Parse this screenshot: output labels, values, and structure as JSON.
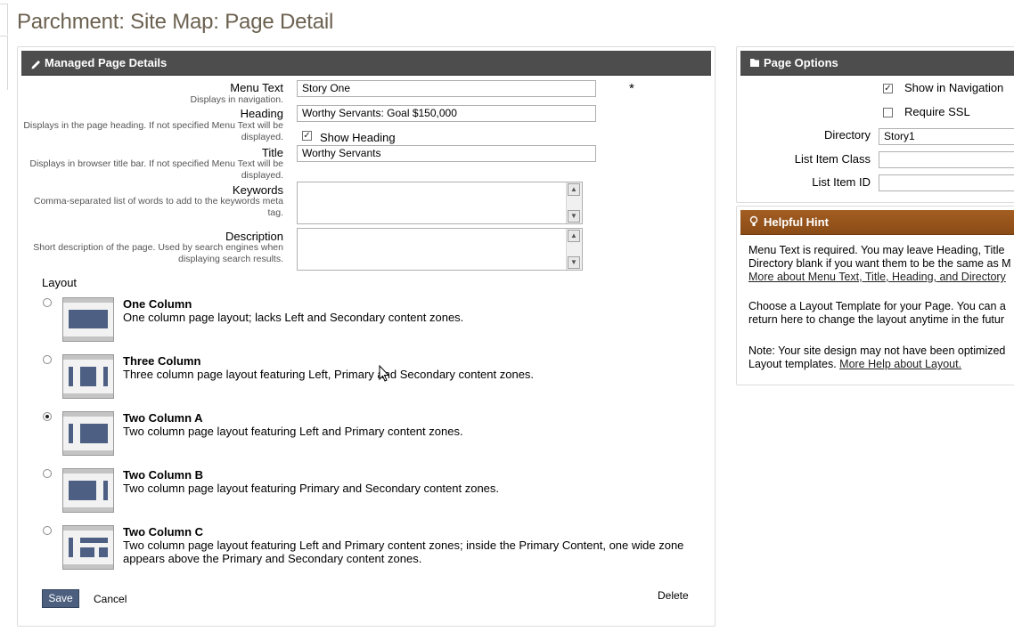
{
  "page_title": "Parchment: Site Map: Page Detail",
  "main": {
    "header": "Managed Page Details",
    "fields": {
      "menu_text": {
        "label": "Menu Text",
        "sub": "Displays in navigation.",
        "value": "Story One",
        "required_mark": "*"
      },
      "heading": {
        "label": "Heading",
        "sub": "Displays in the page heading. If not specified Menu Text will be displayed.",
        "value": "Worthy Servants: Goal $150,000"
      },
      "show_heading": {
        "label": "Show Heading",
        "checked": true
      },
      "title": {
        "label": "Title",
        "sub": "Displays in browser title bar. If not specified Menu Text will be displayed.",
        "value": "Worthy Servants"
      },
      "keywords": {
        "label": "Keywords",
        "sub": "Comma-separated list of words to add to the keywords meta tag.",
        "value": ""
      },
      "description": {
        "label": "Description",
        "sub": "Short description of the page. Used by search engines when displaying search results.",
        "value": ""
      }
    },
    "layout_label": "Layout",
    "layouts": [
      {
        "title": "One Column",
        "desc": "One column page layout; lacks Left and Secondary content zones.",
        "selected": false
      },
      {
        "title": "Three Column",
        "desc": "Three column page layout featuring Left, Primary and Secondary content zones.",
        "selected": false
      },
      {
        "title": "Two Column A",
        "desc": "Two column page layout featuring Left and Primary content zones.",
        "selected": true
      },
      {
        "title": "Two Column B",
        "desc": "Two column page layout featuring Primary and Secondary content zones.",
        "selected": false
      },
      {
        "title": "Two Column C",
        "desc": "Two column page layout featuring Left and Primary content zones; inside the Primary Content, one wide zone",
        "desc2": "appears above the Primary and Secondary content zones.",
        "selected": false
      }
    ],
    "save": "Save",
    "cancel": "Cancel",
    "delete": "Delete"
  },
  "options": {
    "header": "Page Options",
    "show_in_navigation": {
      "label": "Show in Navigation",
      "checked": true
    },
    "require_ssl": {
      "label": "Require SSL",
      "checked": false
    },
    "directory": {
      "label": "Directory",
      "value": "Story1"
    },
    "list_item_class": {
      "label": "List Item Class",
      "value": ""
    },
    "list_item_id": {
      "label": "List Item ID",
      "value": ""
    }
  },
  "hint": {
    "header": "Helpful Hint",
    "p1_line1": "Menu Text is required. You may leave Heading, Title",
    "p1_line2": "Directory blank if you want them to be the same as M",
    "p1_link": "More about Menu Text, Title, Heading, and Directory",
    "p2_line1": "Choose a Layout Template for your Page. You can a",
    "p2_line2": "return here to change the layout anytime in the futur",
    "p3_line1": "Note: Your site design may not have been optimized",
    "p3_line2_text": "Layout templates.",
    "p3_link": "More Help about Layout."
  },
  "colors": {
    "title": "#6b6150",
    "header_dark": "#4d4d4d",
    "header_brown": "#98561c",
    "layout_zone": "#4d5f82",
    "save_button": "#4c5f7f"
  }
}
